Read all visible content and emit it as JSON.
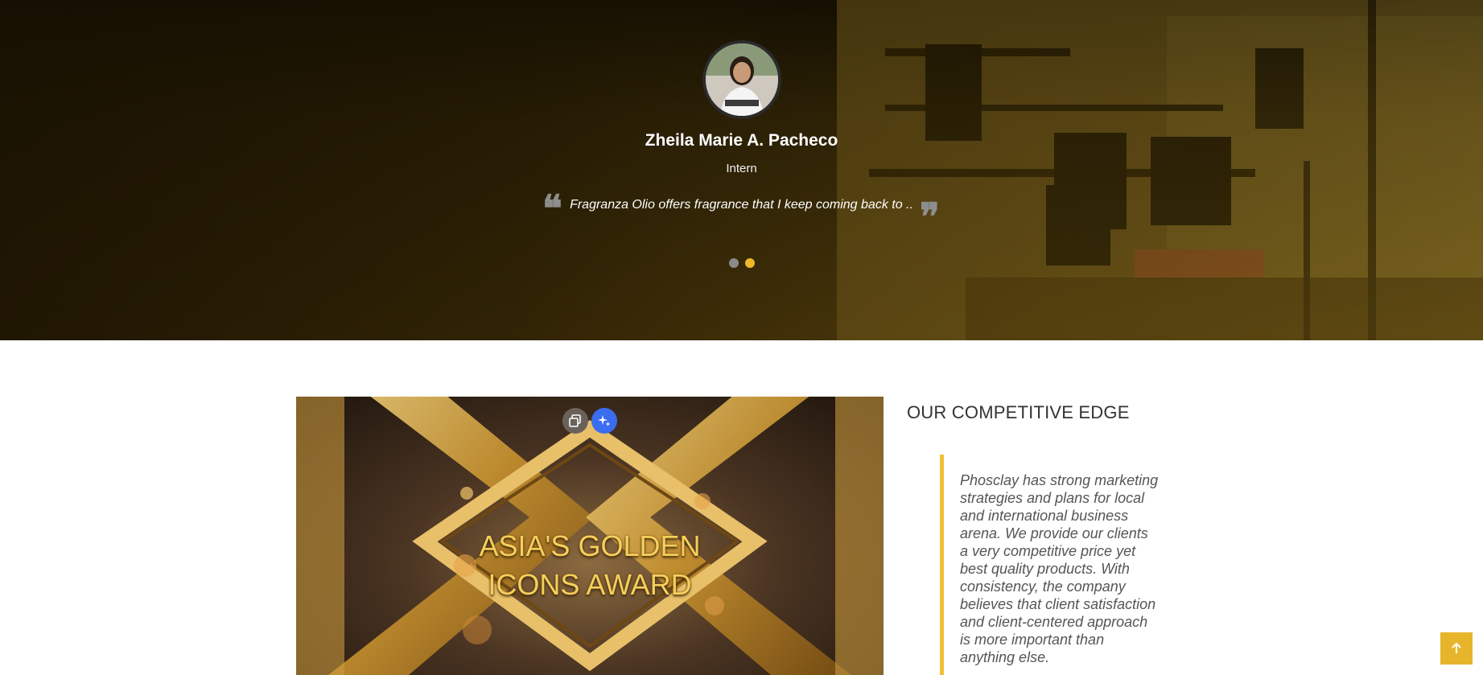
{
  "testimonial": {
    "name": "Zheila Marie A. Pacheco",
    "role": "Intern",
    "quote": "Fragranza Olio offers fragrance that I keep coming back to ..",
    "quote_open_glyph": "❝",
    "quote_close_glyph": "❞",
    "slides": [
      {
        "active": false
      },
      {
        "active": true
      }
    ]
  },
  "video": {
    "title_line1": "ASIA'S GOLDEN",
    "title_line2": "ICONS AWARD",
    "copy_icon": "copy-icon",
    "ai_icon": "sparkle-icon"
  },
  "edge": {
    "title": "OUR COMPETITIVE EDGE",
    "text": "Phosclay has strong marketing strategies and plans for local and international business arena. We provide our clients a very competitive price yet best quality products. With consistency, the company believes that client satisfaction and client-centered approach is more important than anything else."
  },
  "back_to_top": {
    "icon": "arrow-up-icon"
  },
  "colors": {
    "accent": "#f0b72a",
    "quote_border": "#f0bf3a",
    "back_to_top": "#e7b52c",
    "ai_button": "#3b6df0"
  }
}
